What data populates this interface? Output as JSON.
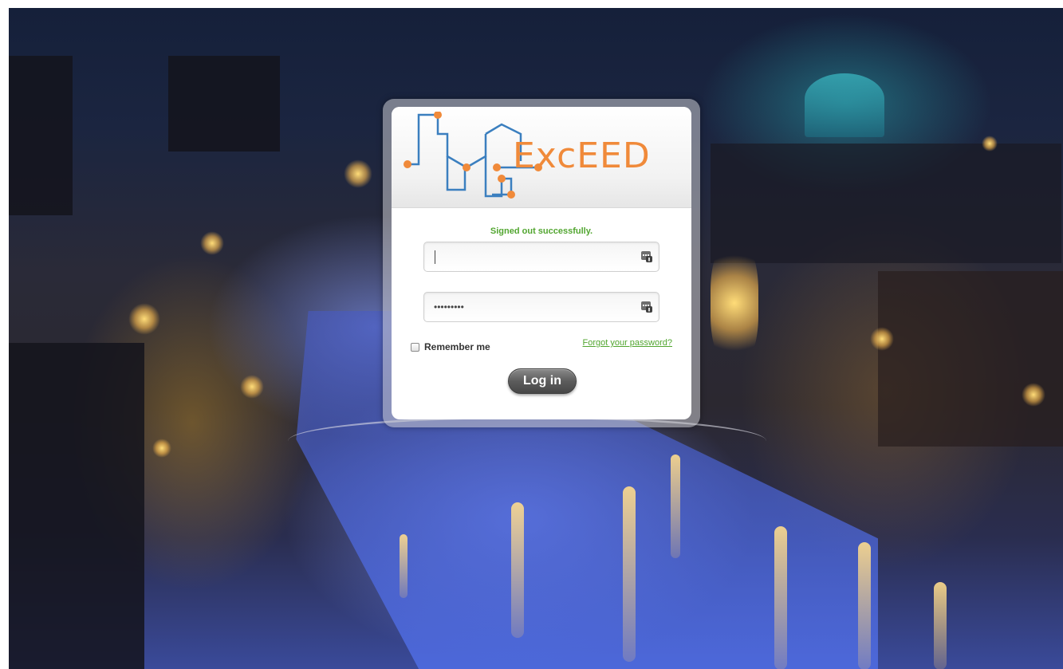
{
  "brand": {
    "logo_text": "ExcEED",
    "colors": {
      "logo_orange": "#f08a3a",
      "logo_blue": "#3b7fbf",
      "success_green": "#52a630",
      "button_gray": "#5c5c5c"
    }
  },
  "flash": {
    "message": "Signed out successfully."
  },
  "form": {
    "email": {
      "value": "",
      "icon": "key-credential-icon"
    },
    "password": {
      "masked_value": "•••••••••",
      "icon": "key-credential-icon"
    },
    "remember_me": {
      "label": "Remember me",
      "checked": false
    },
    "forgot_password_link": "Forgot your password?",
    "submit_label": "Log in"
  }
}
